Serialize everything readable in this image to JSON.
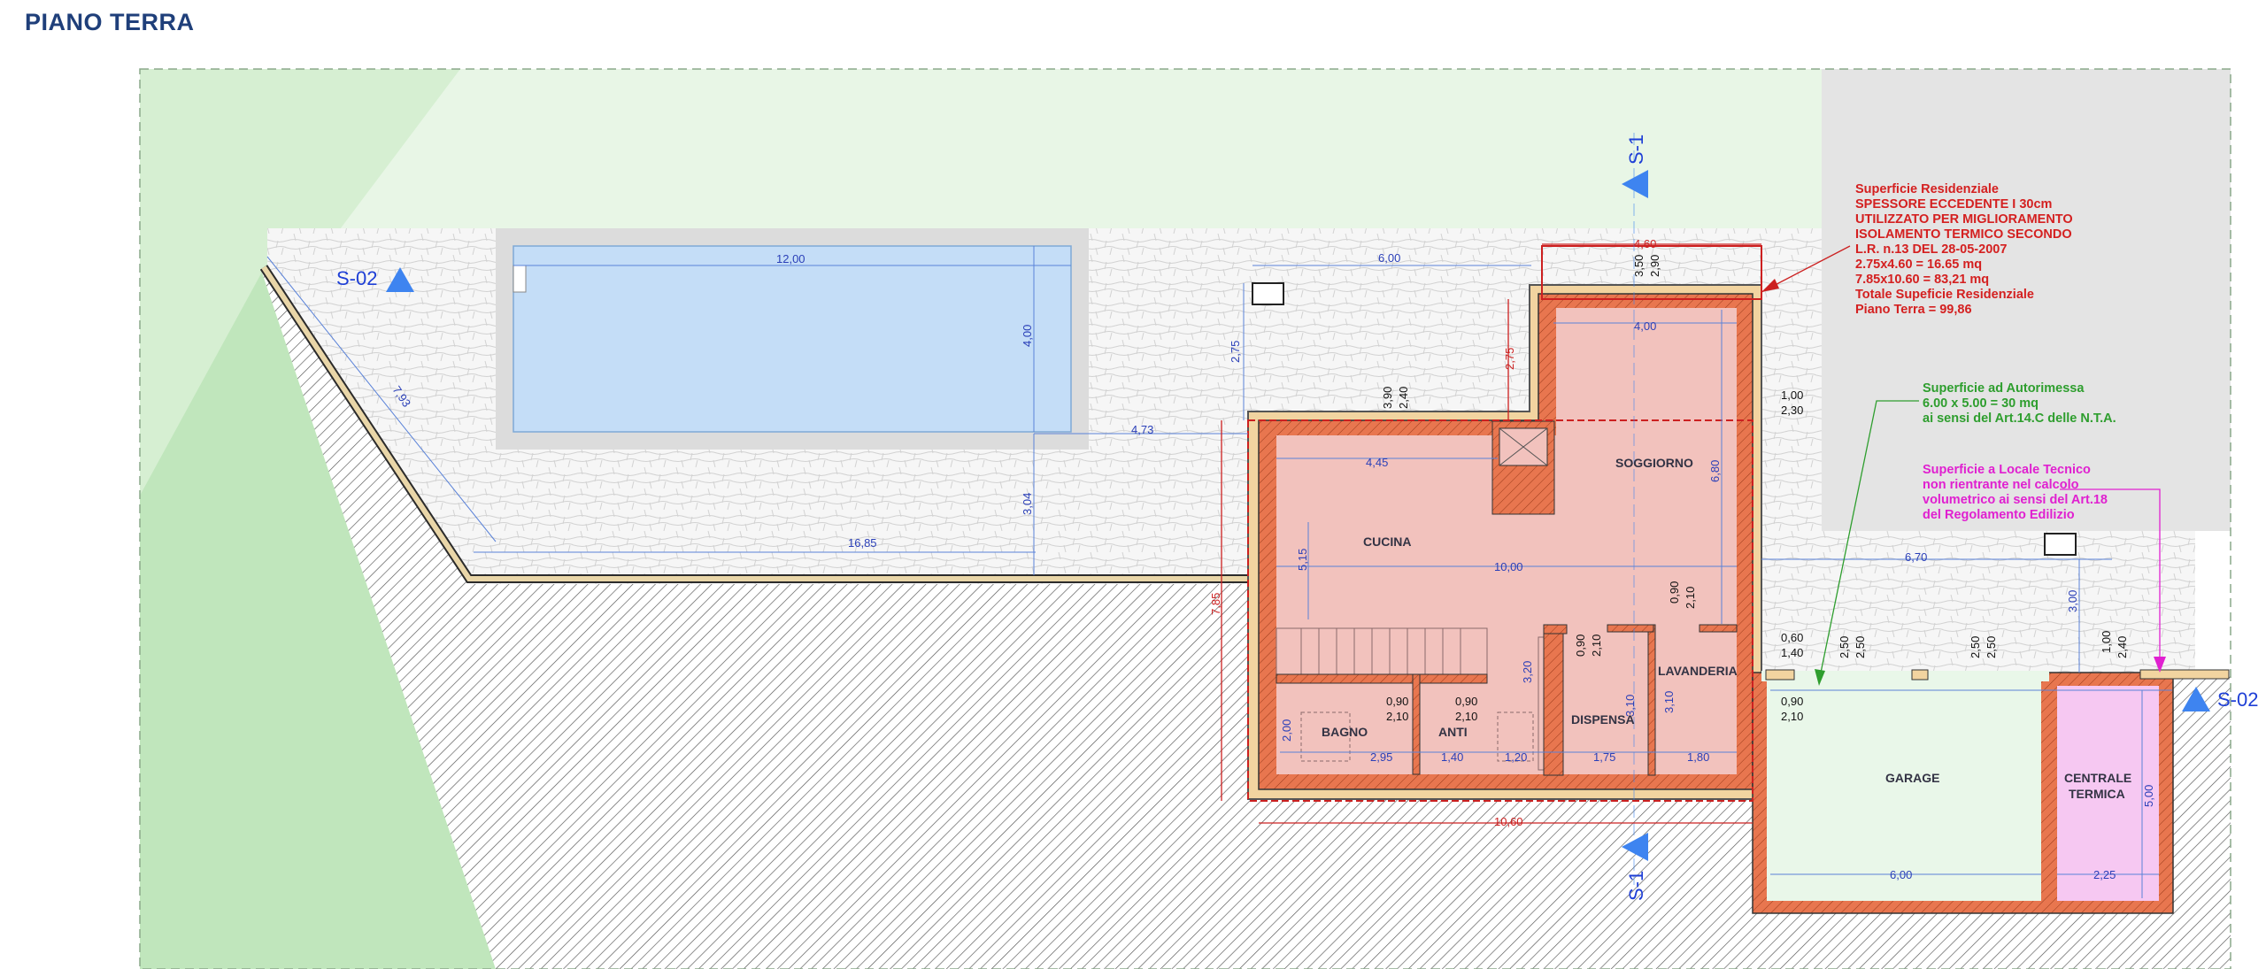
{
  "title": "PIANO TERRA",
  "colors": {
    "lawn": "#c0e6bc",
    "lawn_light": "#e8f6e6",
    "paving": "#f3f3f3",
    "pool_water": "#c4ddf7",
    "pool_deck": "#dcdcdc",
    "residential": "#f2c2bd",
    "wall": "#e8764f",
    "garage": "#e9f7e9",
    "technical": "#f6c8f2",
    "grey_zone": "#e4e4e4",
    "note_red": "#d42020",
    "note_green": "#2e9e2e",
    "note_magenta": "#e020d0",
    "dimension_blue": "#2a3fb8"
  },
  "rooms": {
    "soggiorno": "SOGGIORNO",
    "cucina": "CUCINA",
    "bagno": "BAGNO",
    "anti": "ANTI",
    "dispensa": "DISPENSA",
    "lavanderia": "LAVANDERIA",
    "garage": "GARAGE",
    "centrale_line1": "CENTRALE",
    "centrale_line2": "TERMICA"
  },
  "sections": {
    "s1_top": "S-1",
    "s1_bottom": "S-1",
    "s02_left": "S-02",
    "s02_right": "S-02"
  },
  "notes": {
    "residenziale": [
      "Superficie Residenziale",
      "SPESSORE ECCEDENTE I 30cm",
      "UTILIZZATO PER MIGLIORAMENTO",
      "ISOLAMENTO TERMICO SECONDO",
      "L.R. n.13 DEL 28-05-2007",
      "2.75x4.60 = 16.65 mq",
      "7.85x10.60 = 83,21 mq",
      "Totale Supeficie Residenziale",
      "Piano Terra = 99,86"
    ],
    "autorimessa": [
      "Superficie ad Autorimessa",
      "6.00 x 5.00 = 30 mq",
      "ai sensi del Art.14.C delle N.T.A."
    ],
    "tecnico": [
      "Superficie a Locale Tecnico",
      "non rientrante nel calcolo",
      "volumetrico ai sensi del Art.18",
      "del Regolamento Edilizio"
    ]
  },
  "dimensions": {
    "pool_length": "12,00",
    "pool_width": "4,00",
    "slope_edge": "7,93",
    "terrace_length": "16,85",
    "terrace_depth": "3,04",
    "to_house": "4,73",
    "top_width": "6,00",
    "top_depth": "2,75",
    "red_top_width": "4,60",
    "red_left_depth": "2,75",
    "red_height": "7,85",
    "red_width": "10,60",
    "w390": "3,90",
    "w240": "2,40",
    "w350": "3,50",
    "w290": "2,90",
    "soggiorno_width": "4,00",
    "soggiorno_depth": "6,80",
    "cucina_width": "4,45",
    "cucina_depth": "5,15",
    "house_width": "10,00",
    "win_100": "1,00",
    "win_230": "2,30",
    "garage_total_to_edge": "6,70",
    "garage_side_depth": "3,00",
    "d090_lav": "0,90",
    "d210_lav": "2,10",
    "d090_disp": "0,90",
    "d210_disp": "2,10",
    "disp_depth": "3,20",
    "lav_depth_a": "3,10",
    "lav_depth_b": "3,10",
    "win_060": "0,60",
    "win_140": "1,40",
    "g250_a": "2,50",
    "g250_b": "2,50",
    "g250_c": "2,50",
    "g250_d": "2,50",
    "g100": "1,00",
    "g240": "2,40",
    "bath_door_090": "0,90",
    "bath_door_210": "2,10",
    "anti_door_090": "0,90",
    "anti_door_210": "2,10",
    "bath_depth": "2,00",
    "bath_width": "2,95",
    "anti_width": "1,40",
    "w120": "1,20",
    "disp_width": "1,75",
    "lav_width": "1,80",
    "garage_door_090": "0,90",
    "garage_door_210": "2,10",
    "garage_depth": "5,00",
    "garage_width": "6,00",
    "centrale_width": "2,25"
  }
}
